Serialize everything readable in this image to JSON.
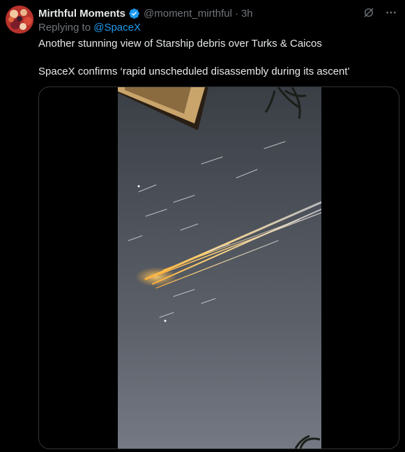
{
  "tweet": {
    "author_name": "Mirthful Moments",
    "handle": "@moment_mirthful",
    "separator": "·",
    "time": "3h",
    "reply_prefix": "Replying to ",
    "reply_to": "@SpaceX",
    "text_line1": "Another stunning view of Starship debris over Turks & Caicos",
    "text_line2": "SpaceX confirms ‘rapid unscheduled disassembly during its ascent’"
  },
  "icons": {
    "verified": "verified-badge-icon",
    "grok": "grok-icon",
    "more": "more-icon"
  },
  "colors": {
    "background": "#000000",
    "text_primary": "#e7e9ea",
    "text_secondary": "#71767b",
    "link": "#1d9bf0",
    "border": "#2f3336"
  }
}
